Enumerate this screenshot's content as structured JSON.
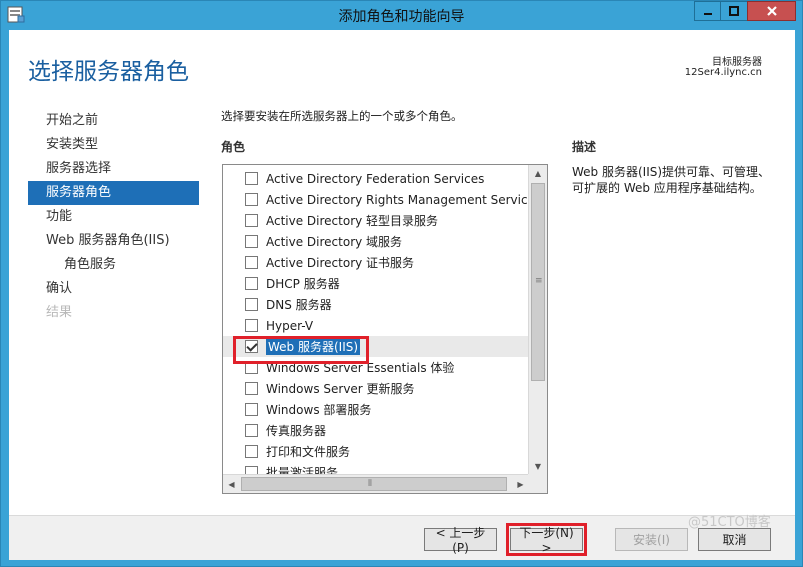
{
  "window": {
    "title": "添加角色和功能向导",
    "icon": "server-manager-icon",
    "controls": {
      "minimize": "minimize-icon",
      "maximize": "maximize-icon",
      "close": "close-icon"
    }
  },
  "header": {
    "page_title": "选择服务器角色",
    "target_label": "目标服务器",
    "target_host": "12Ser4.ilync.cn"
  },
  "nav": {
    "items": [
      {
        "label": "开始之前",
        "state": "normal"
      },
      {
        "label": "安装类型",
        "state": "normal"
      },
      {
        "label": "服务器选择",
        "state": "normal"
      },
      {
        "label": "服务器角色",
        "state": "selected"
      },
      {
        "label": "功能",
        "state": "normal"
      },
      {
        "label": "Web 服务器角色(IIS)",
        "state": "normal"
      },
      {
        "label": "角色服务",
        "state": "sub"
      },
      {
        "label": "确认",
        "state": "normal"
      },
      {
        "label": "结果",
        "state": "disabled"
      }
    ]
  },
  "main": {
    "instruction": "选择要安装在所选服务器上的一个或多个角色。",
    "roles_heading": "角色",
    "description_heading": "描述",
    "description_text": "Web 服务器(IIS)提供可靠、可管理、可扩展的 Web 应用程序基础结构。",
    "roles": [
      {
        "label": "Active Directory Federation Services",
        "checked": false
      },
      {
        "label": "Active Directory Rights Management Services",
        "checked": false
      },
      {
        "label": "Active Directory 轻型目录服务",
        "checked": false
      },
      {
        "label": "Active Directory 域服务",
        "checked": false
      },
      {
        "label": "Active Directory 证书服务",
        "checked": false
      },
      {
        "label": "DHCP 服务器",
        "checked": false
      },
      {
        "label": "DNS 服务器",
        "checked": false
      },
      {
        "label": "Hyper-V",
        "checked": false
      },
      {
        "label": "Web 服务器(IIS)",
        "checked": true
      },
      {
        "label": "Windows Server Essentials 体验",
        "checked": false
      },
      {
        "label": "Windows Server 更新服务",
        "checked": false
      },
      {
        "label": "Windows 部署服务",
        "checked": false
      },
      {
        "label": "传真服务器",
        "checked": false
      },
      {
        "label": "打印和文件服务",
        "checked": false
      },
      {
        "label": "批量激活服务",
        "checked": false
      }
    ]
  },
  "footer": {
    "prev_label": "< 上一步(P)",
    "next_label": "下一步(N) >",
    "install_label": "安装(I)",
    "cancel_label": "取消"
  },
  "watermark": "@51CTO博客",
  "colors": {
    "titlebar": "#3aa3d6",
    "accent": "#1e6fb7",
    "page_title": "#1a5fa0",
    "highlight": "#e0202a",
    "close_button": "#c75050"
  }
}
